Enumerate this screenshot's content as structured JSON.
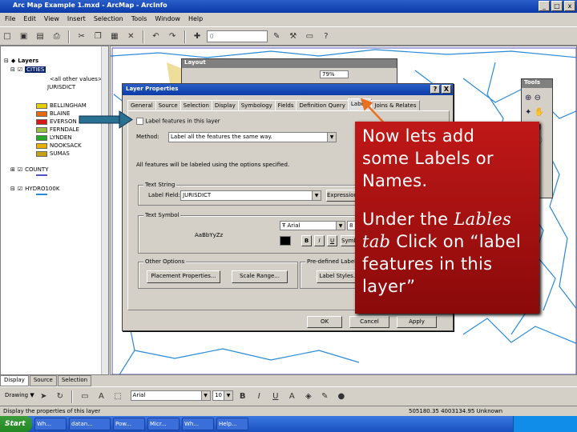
{
  "window": {
    "title": "Arc Map Example 1.mxd - ArcMap - ArcInfo",
    "min": "_",
    "max": "□",
    "close": "x"
  },
  "menu": [
    "File",
    "Edit",
    "View",
    "Insert",
    "Selection",
    "Tools",
    "Window",
    "Help"
  ],
  "toolbar": {
    "scale_value": "0"
  },
  "toc": {
    "root": "Layers",
    "layer1": "CITIES",
    "layer1_sub": "<all other values>",
    "layer1_field": "JURISDICT",
    "classes": [
      {
        "label": "BELLINGHAM",
        "color": "#e8d000"
      },
      {
        "label": "BLAINE",
        "color": "#e86a10"
      },
      {
        "label": "EVERSON",
        "color": "#d81818"
      },
      {
        "label": "FERNDALE",
        "color": "#98c040"
      },
      {
        "label": "LYNDEN",
        "color": "#28a828"
      },
      {
        "label": "NOOKSACK",
        "color": "#e8b000"
      },
      {
        "label": "SUMAS",
        "color": "#c8a018"
      }
    ],
    "layer2": "COUNTY",
    "layer3": "HYDRO100K",
    "tabs": [
      "Display",
      "Source",
      "Selection"
    ]
  },
  "layout_window": {
    "title": "Layout",
    "zoom": "79%"
  },
  "tools_window": {
    "title": "Tools"
  },
  "dialog": {
    "title": "Layer Properties",
    "help": "?",
    "close": "X",
    "tabs": [
      "General",
      "Source",
      "Selection",
      "Display",
      "Symbology",
      "Fields",
      "Definition Query",
      "Labels",
      "Joins & Relates"
    ],
    "active_tab": "Labels",
    "checkbox_label": "Label features in this layer",
    "method_label": "Method:",
    "method_value": "Label all the features the same way.",
    "info_text": "All features will be labeled using the options specified.",
    "text_string_group": "Text String",
    "label_field_label": "Label Field:",
    "label_field_value": "JURISDICT",
    "expression_button": "Expression...",
    "text_symbol_group": "Text Symbol",
    "sample_text": "AaBbYyZz",
    "font_value": "Arial",
    "size_value": "8",
    "bold": "B",
    "italic": "I",
    "underline": "U",
    "symbol_button": "Symbol...",
    "other_options_group": "Other Options",
    "placement_button": "Placement Properties...",
    "scale_range_button": "Scale Range...",
    "predefined_group": "Pre-defined Label Style",
    "label_styles_button": "Label Styles...",
    "ok": "OK",
    "cancel": "Cancel",
    "apply": "Apply"
  },
  "callout": {
    "line1": "Now lets add",
    "line2": "some Labels or",
    "line3": "Names.",
    "line4_pre": "Under the ",
    "line4_italic": "Lables",
    "line5_italic": "tab",
    "line5_post": " Click on “label",
    "line6": "features in this",
    "line7": "layer”",
    "colors": {
      "box": "#b01010",
      "arrow_orange": "#e87020",
      "arrow_blue": "#2a7090"
    }
  },
  "drawbar": {
    "drawing": "Drawing ▼",
    "font": "Arial",
    "size": "10",
    "bold": "B",
    "italic": "I",
    "underline": "U",
    "text_tool": "A"
  },
  "status": {
    "message": "Display the properties of this layer",
    "coords": "505180.35 4003134.95 Unknown"
  },
  "taskbar": {
    "start": "Start",
    "tasks": [
      "Wh...",
      "datan...",
      "Pow...",
      "Micr...",
      "Wh...",
      "Help..."
    ]
  }
}
